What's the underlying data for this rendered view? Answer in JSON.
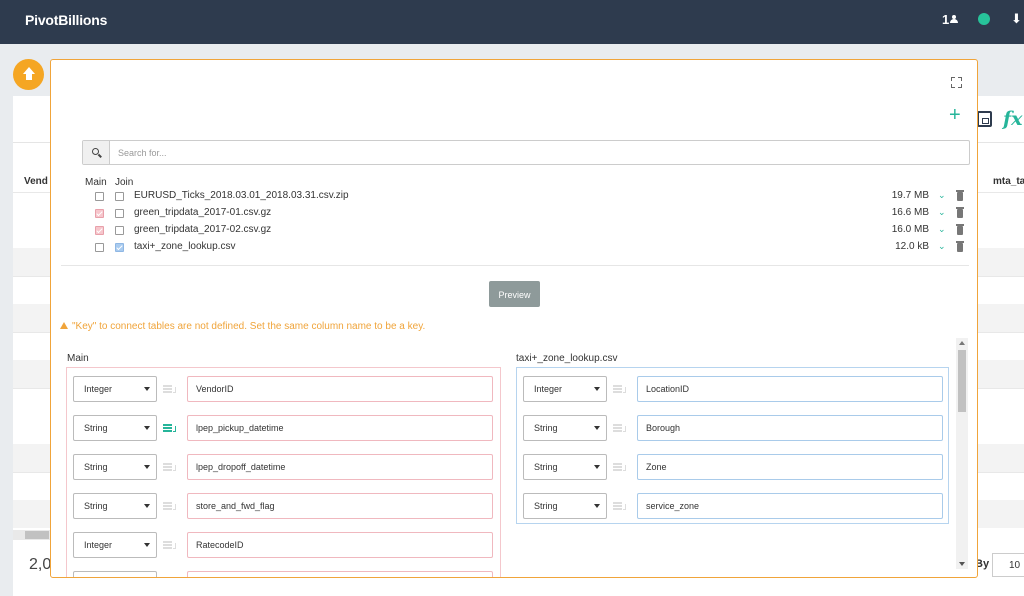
{
  "app": {
    "title": "PivotBillions",
    "user_count": "1"
  },
  "background": {
    "col_left": "Vend",
    "col_right": "mta_ta",
    "count": "2,0",
    "by_label": "By",
    "by_value": "10"
  },
  "modal": {
    "search_placeholder": "Search for...",
    "col_main": "Main",
    "col_join": "Join",
    "files": [
      {
        "name": "EURUSD_Ticks_2018.03.01_2018.03.31.csv.zip",
        "size": "19.7 MB",
        "main": false,
        "join": false
      },
      {
        "name": "green_tripdata_2017-01.csv.gz",
        "size": "16.6 MB",
        "main": true,
        "join": false
      },
      {
        "name": "green_tripdata_2017-02.csv.gz",
        "size": "16.0 MB",
        "main": true,
        "join": false
      },
      {
        "name": "taxi+_zone_lookup.csv",
        "size": "12.0 kB",
        "main": false,
        "join": true
      }
    ],
    "preview_label": "Preview",
    "warning": "\"Key\" to connect tables are not defined. Set the same column name to be a key.",
    "main_panel": {
      "title": "Main",
      "columns": [
        {
          "type": "Integer",
          "name": "VendorID",
          "key": false
        },
        {
          "type": "String",
          "name": "lpep_pickup_datetime",
          "key": true
        },
        {
          "type": "String",
          "name": "lpep_dropoff_datetime",
          "key": false
        },
        {
          "type": "String",
          "name": "store_and_fwd_flag",
          "key": false
        },
        {
          "type": "Integer",
          "name": "RatecodeID",
          "key": false
        }
      ]
    },
    "join_panel": {
      "title": "taxi+_zone_lookup.csv",
      "columns": [
        {
          "type": "Integer",
          "name": "LocationID",
          "key": false
        },
        {
          "type": "String",
          "name": "Borough",
          "key": false
        },
        {
          "type": "String",
          "name": "Zone",
          "key": false
        },
        {
          "type": "String",
          "name": "service_zone",
          "key": false
        }
      ]
    }
  },
  "colors": {
    "accent": "#26b59a",
    "warning": "#f0a43a",
    "topbar": "#2e3b4e",
    "main_border": "#f4c7cc",
    "join_border": "#b6d4ef"
  }
}
